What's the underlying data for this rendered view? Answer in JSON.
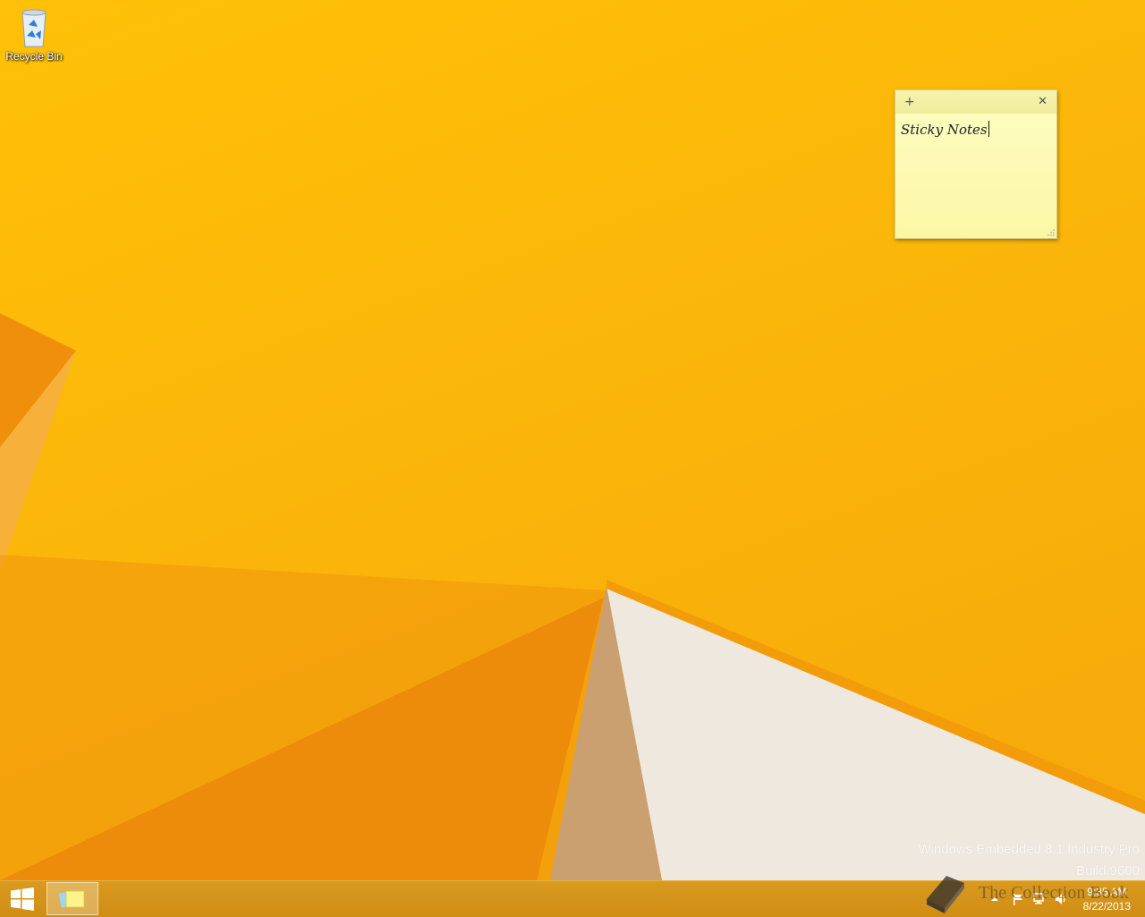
{
  "desktop": {
    "recycle_bin_label": "Recycle Bin"
  },
  "sticky_note": {
    "add_label": "+",
    "close_label": "✕",
    "text": "Sticky Notes"
  },
  "watermark": {
    "edition": "Windows Embedded 8.1 Industry Pro",
    "build": "Build 9600"
  },
  "taskbar": {
    "clock_time": "9:35 AM",
    "clock_date": "8/22/2013"
  },
  "brand": {
    "text": "The Collection Book"
  },
  "icons": {
    "start": "windows-logo-icon",
    "app": "sticky-notes-icon",
    "tray": [
      "show-hidden-icons-chevron",
      "action-center-flag-icon",
      "network-icon",
      "volume-icon"
    ]
  },
  "colors": {
    "wallpaper_primary": "#fbb60a",
    "wallpaper_dark": "#e8830a",
    "note_yellow": "#fdfdc2",
    "taskbar": "#cf8d14"
  }
}
